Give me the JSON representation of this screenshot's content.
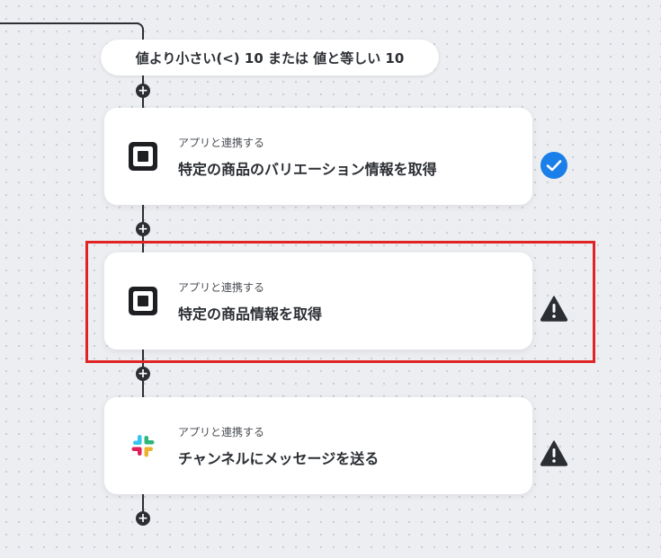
{
  "condition": {
    "label": "値より小さい(<) 10 または 値と等しい 10"
  },
  "steps": [
    {
      "subtitle": "アプリと連携する",
      "title": "特定の商品のバリエーション情報を取得",
      "app_icon": "square-logo-icon",
      "status": "success-check-icon",
      "status_color": "#1a7fe8"
    },
    {
      "subtitle": "アプリと連携する",
      "title": "特定の商品情報を取得",
      "app_icon": "square-logo-icon",
      "status": "warning-icon",
      "status_color": "#2b2e33"
    },
    {
      "subtitle": "アプリと連携する",
      "title": "チャンネルにメッセージを送る",
      "app_icon": "slack-logo-icon",
      "status": "warning-icon",
      "status_color": "#2b2e33"
    }
  ],
  "add_step_symbol": "+",
  "colors": {
    "highlight": "#e02424",
    "line": "#2b2e33",
    "check": "#1a7fe8"
  }
}
